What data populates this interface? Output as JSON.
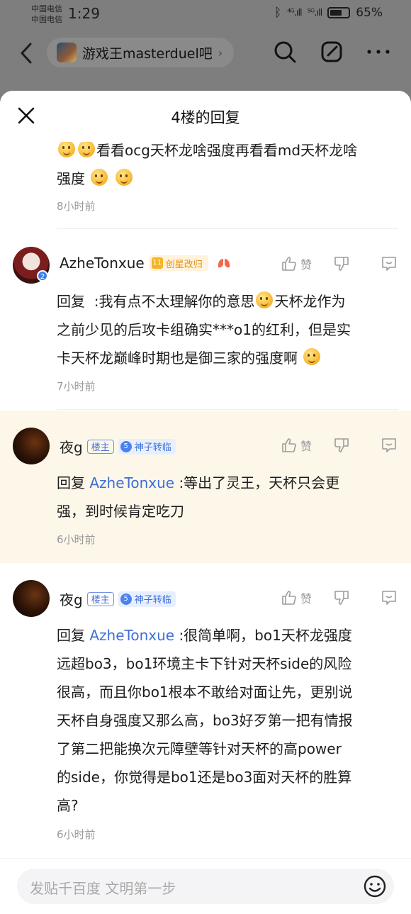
{
  "status_bar": {
    "carrier_1": "中国电信",
    "carrier_2": "中国电信",
    "time": "1:29",
    "signal_1": "⁴ᴳ.ıll",
    "signal_2": "⁵ᴳ.ıll",
    "battery": "65%"
  },
  "nav": {
    "forum_name": "游戏王masterduel吧",
    "chevron": "›"
  },
  "sheet": {
    "title": "4楼的回复",
    "input_placeholder": "发贴千百度 文明第一步"
  },
  "first_reply": {
    "text_part1": "看看ocg天杯龙啥强度再看看md天杯龙啥",
    "text_part2": "强度",
    "time": "8小时前"
  },
  "comments": [
    {
      "username": "AzheTonxue",
      "level": "11",
      "badge": "创星改归",
      "avatar_level": "2",
      "like_label": "赞",
      "reply_prefix": "回复",
      "mention": "",
      "line1": ":我有点不太理解你的意思",
      "line1b": "天杯龙作为",
      "line2": "之前少见的后攻卡组确实***o1的红利，但是实",
      "line3": "卡天杯龙巅峰时期也是御三家的强度啊",
      "time": "7小时前"
    },
    {
      "username": "夜g",
      "host_badge": "楼主",
      "level": "5",
      "badge": "神子转临",
      "like_label": "赞",
      "reply_prefix": "回复",
      "mention": "AzheTonxue",
      "line1": ":等出了灵王，天杯只会更",
      "line2": "强，到时候肯定吃刀",
      "time": "6小时前"
    },
    {
      "username": "夜g",
      "host_badge": "楼主",
      "level": "5",
      "badge": "神子转临",
      "like_label": "赞",
      "reply_prefix": "回复",
      "mention": "AzheTonxue",
      "line1": ":很简单啊，bo1天杯龙强度",
      "line2": "远超bo3，bo1环境主卡下针对天杯side的风险",
      "line3": "很高，而且你bo1根本不敢给对面让先，更别说",
      "line4": "天杯自身强度又那么高，bo3好歹第一把有情报",
      "line5": "了第二把能换次元障壁等针对天杯的高power",
      "line6": "的side，你觉得是bo1还是bo3面对天杯的胜算",
      "line7": "高?",
      "time": "6小时前"
    }
  ]
}
